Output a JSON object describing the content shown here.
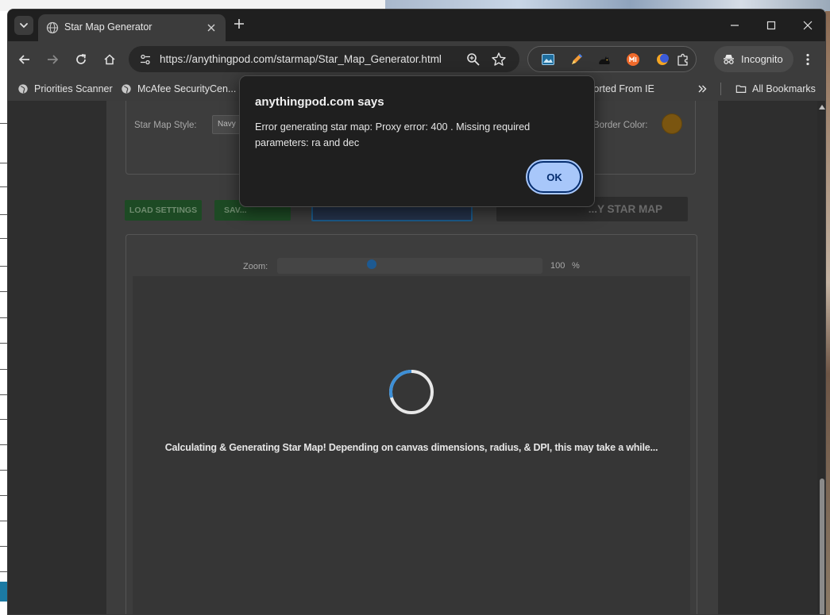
{
  "browser": {
    "tab_title": "Star Map Generator",
    "url": "https://anythingpod.com/starmap/Star_Map_Generator.html",
    "profile_label": "Incognito",
    "bookmarks": {
      "item1": "Priorities Scanner",
      "item2": "McAfee SecurityCen...",
      "item3": "...orted From IE",
      "all_bookmarks": "All Bookmarks"
    }
  },
  "page": {
    "style_label": "Star Map Style:",
    "style_value": "Navy",
    "border_color_label": "Border Color:",
    "border_color": "#7a5510",
    "load_button": "LOAD SETTINGS",
    "save_button": "SAV...",
    "generate_button": "...Y STAR MAP",
    "zoom_label": "Zoom:",
    "zoom_value": "100",
    "zoom_unit": "%",
    "zoom_level": 0.35,
    "loading_text": "Calculating & Generating Star Map! Depending on canvas dimensions, radius, & DPI, this may take a while..."
  },
  "dialog": {
    "title": "anythingpod.com says",
    "message": "Error generating star map: Proxy error: 400 . Missing required parameters: ra and dec",
    "ok_label": "OK"
  },
  "colors": {
    "dialog_button": "#a8c7fa",
    "spinner_accent": "#3d8fd6"
  }
}
